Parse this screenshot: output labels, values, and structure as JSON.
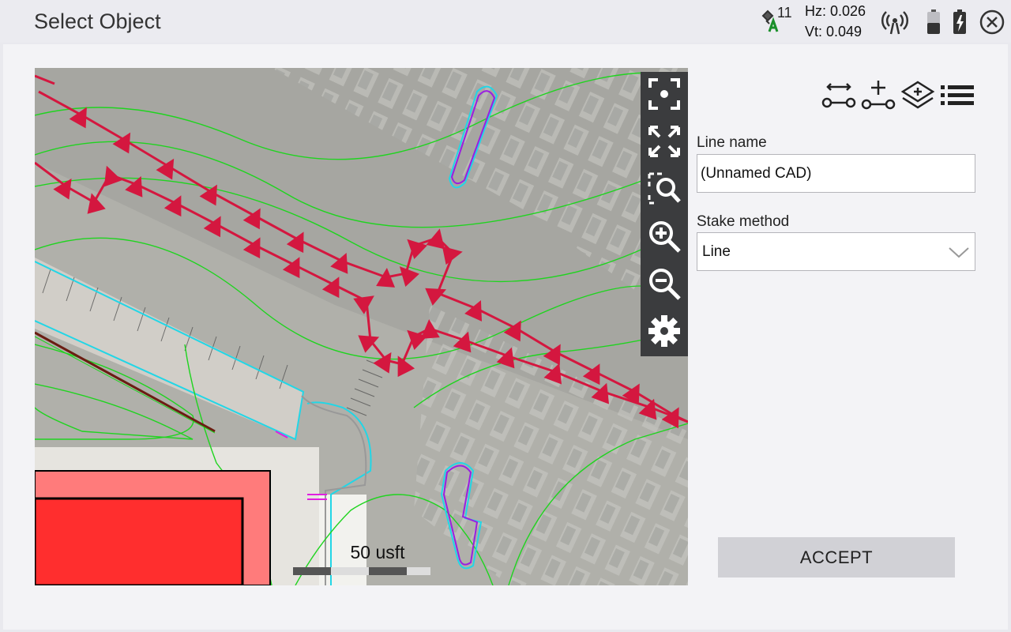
{
  "header": {
    "title": "Select Object",
    "satellite_count": "11",
    "hz": "Hz: 0.026",
    "vt": "Vt: 0.049",
    "icons": [
      "satellite-icon",
      "radio-icon",
      "battery-icon",
      "battery-charging-icon",
      "close-icon"
    ]
  },
  "map": {
    "scale_label": "50 usft",
    "toolbar_icons": [
      "zoom-to-selection-icon",
      "zoom-extents-icon",
      "zoom-window-icon",
      "zoom-in-icon",
      "zoom-out-icon",
      "settings-icon"
    ]
  },
  "panel": {
    "top_icons": [
      "line-between-points-icon",
      "add-point-icon",
      "layers-icon",
      "list-icon"
    ],
    "line_name_label": "Line name",
    "line_name_value": "(Unnamed CAD)",
    "stake_method_label": "Stake method",
    "stake_method_value": "Line",
    "accept_label": "ACCEPT"
  },
  "colors": {
    "accent_red": "#d4173f",
    "contour_green": "#1fd41f",
    "cyan_line": "#22d6e6",
    "building_fill": "#ff3b3b"
  }
}
